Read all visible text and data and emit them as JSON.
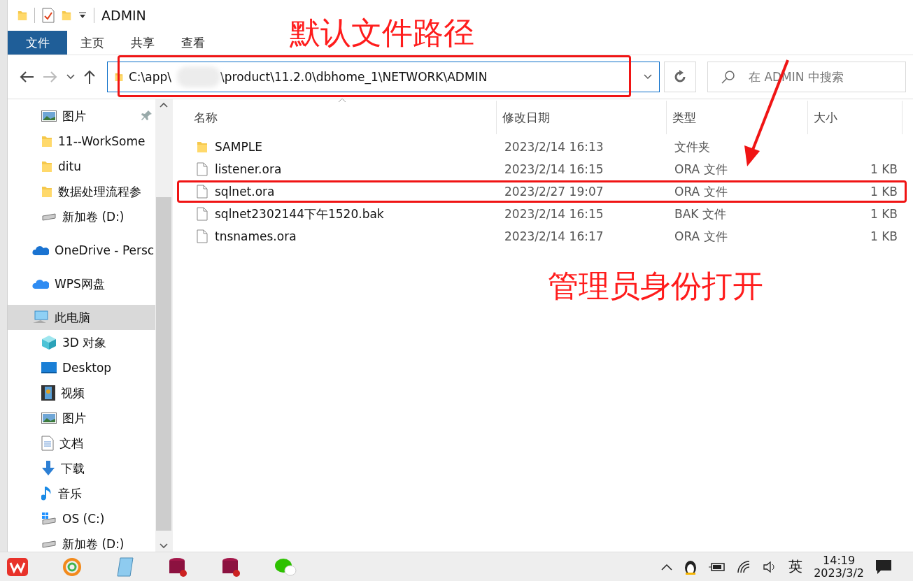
{
  "window": {
    "title": "ADMIN"
  },
  "ribbon_tabs": [
    {
      "label": "文件",
      "selected": true
    },
    {
      "label": "主页",
      "selected": false
    },
    {
      "label": "共享",
      "selected": false
    },
    {
      "label": "查看",
      "selected": false
    }
  ],
  "address": {
    "segments": [
      "C:\\app\\",
      "\\product\\11.2.0\\dbhome_1\\NETWORK\\ADMIN"
    ]
  },
  "search": {
    "placeholder": "在 ADMIN 中搜索"
  },
  "sidebar": {
    "quick_access": [
      {
        "label": "图片",
        "kind": "pictures",
        "pinned": true,
        "selected": false
      },
      {
        "label": "11--WorkSome",
        "kind": "folder",
        "pinned": false,
        "selected": false
      },
      {
        "label": "ditu",
        "kind": "folder",
        "pinned": false,
        "selected": false
      },
      {
        "label": "数据处理流程参",
        "kind": "folder",
        "pinned": false,
        "selected": false
      },
      {
        "label": "新加卷 (D:)",
        "kind": "drive",
        "pinned": false,
        "selected": false
      }
    ],
    "items": [
      {
        "label": "OneDrive - Persc",
        "kind": "onedrive",
        "selected": false
      },
      {
        "label": "WPS网盘",
        "kind": "cloud",
        "selected": false
      },
      {
        "label": "此电脑",
        "kind": "pc",
        "selected": true,
        "children": [
          {
            "label": "3D 对象",
            "kind": "cube",
            "selected": false
          },
          {
            "label": "Desktop",
            "kind": "desktop",
            "selected": false
          },
          {
            "label": "视频",
            "kind": "video",
            "selected": false
          },
          {
            "label": "图片",
            "kind": "pictures",
            "selected": false
          },
          {
            "label": "文档",
            "kind": "documents",
            "selected": false
          },
          {
            "label": "下载",
            "kind": "downloads",
            "selected": false
          },
          {
            "label": "音乐",
            "kind": "music",
            "selected": false
          },
          {
            "label": "OS (C:)",
            "kind": "osdrive",
            "selected": false
          },
          {
            "label": "新加卷 (D:)",
            "kind": "drive",
            "selected": false
          }
        ]
      }
    ]
  },
  "files": {
    "columns": [
      "名称",
      "修改日期",
      "类型",
      "大小"
    ],
    "rows": [
      {
        "kind": "folder",
        "name": "SAMPLE",
        "modified": "2023/2/14 16:13",
        "type": "文件夹",
        "boxed": false
      },
      {
        "kind": "file",
        "name": "listener.ora",
        "modified": "2023/2/14 16:15",
        "type": "ORA 文件",
        "size": "1 KB",
        "boxed": false
      },
      {
        "kind": "file",
        "name": "sqlnet.ora",
        "modified": "2023/2/27 19:07",
        "type": "ORA 文件",
        "size": "1 KB",
        "boxed": true
      },
      {
        "kind": "file",
        "name": "sqlnet2302144下午1520.bak",
        "modified": "2023/2/14 16:15",
        "type": "BAK 文件",
        "size": "1 KB",
        "boxed": false
      },
      {
        "kind": "file",
        "name": "tnsnames.ora",
        "modified": "2023/2/14 16:17",
        "type": "ORA 文件",
        "size": "1 KB",
        "boxed": false
      }
    ]
  },
  "annotations": [
    {
      "kind": "path-note",
      "text": "默认文件路径"
    },
    {
      "kind": "row-note",
      "text": "管理员身份打开"
    }
  ],
  "taskbar": {
    "ime": "英",
    "time": "14:19",
    "date": "2023/3/2"
  }
}
